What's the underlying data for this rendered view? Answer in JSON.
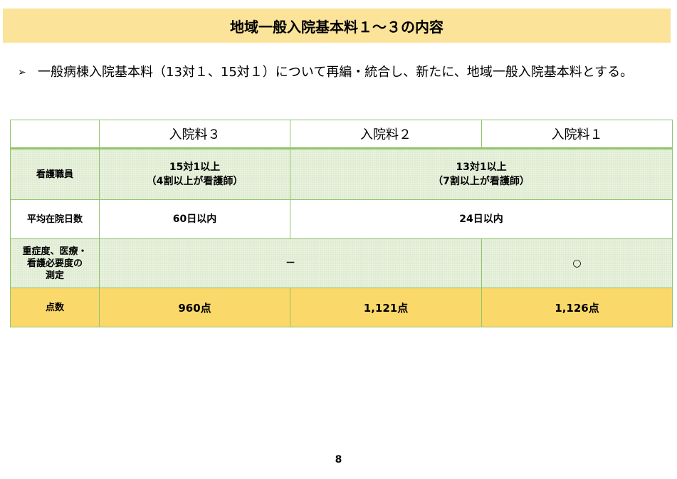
{
  "title": "地域一般入院基本料１～３の内容",
  "bullet": {
    "marker": "➢",
    "text": "一般病棟入院基本料（13対１、15対１）について再編・統合し、新たに、地域一般入院基本料とする。"
  },
  "table": {
    "header": [
      "",
      "入院料３",
      "入院料２",
      "入院料１"
    ],
    "rows": {
      "nurses": {
        "label": "看護職員",
        "col1": {
          "line1": "15対1以上",
          "line2": "（4割以上が看護師）"
        },
        "col23": {
          "line1": "13対1以上",
          "line2": "（7割以上が看護師）"
        }
      },
      "avg_days": {
        "label": "平均在院日数",
        "col1": "60日以内",
        "col23": "24日以内"
      },
      "measurement": {
        "label_line1": "重症度、医療・",
        "label_line2": "看護必要度の",
        "label_line3": "測定",
        "col12": "－",
        "col3": "○"
      },
      "score": {
        "label": "点数",
        "col1": "960点",
        "col2": "1,121点",
        "col3": "1,126点"
      }
    }
  },
  "page_number": "8",
  "colors": {
    "title_bg": "#fbe49a",
    "border": "#92c46a",
    "pattern_bg": "#eef5e6",
    "score_bg": "#fbd86a"
  }
}
